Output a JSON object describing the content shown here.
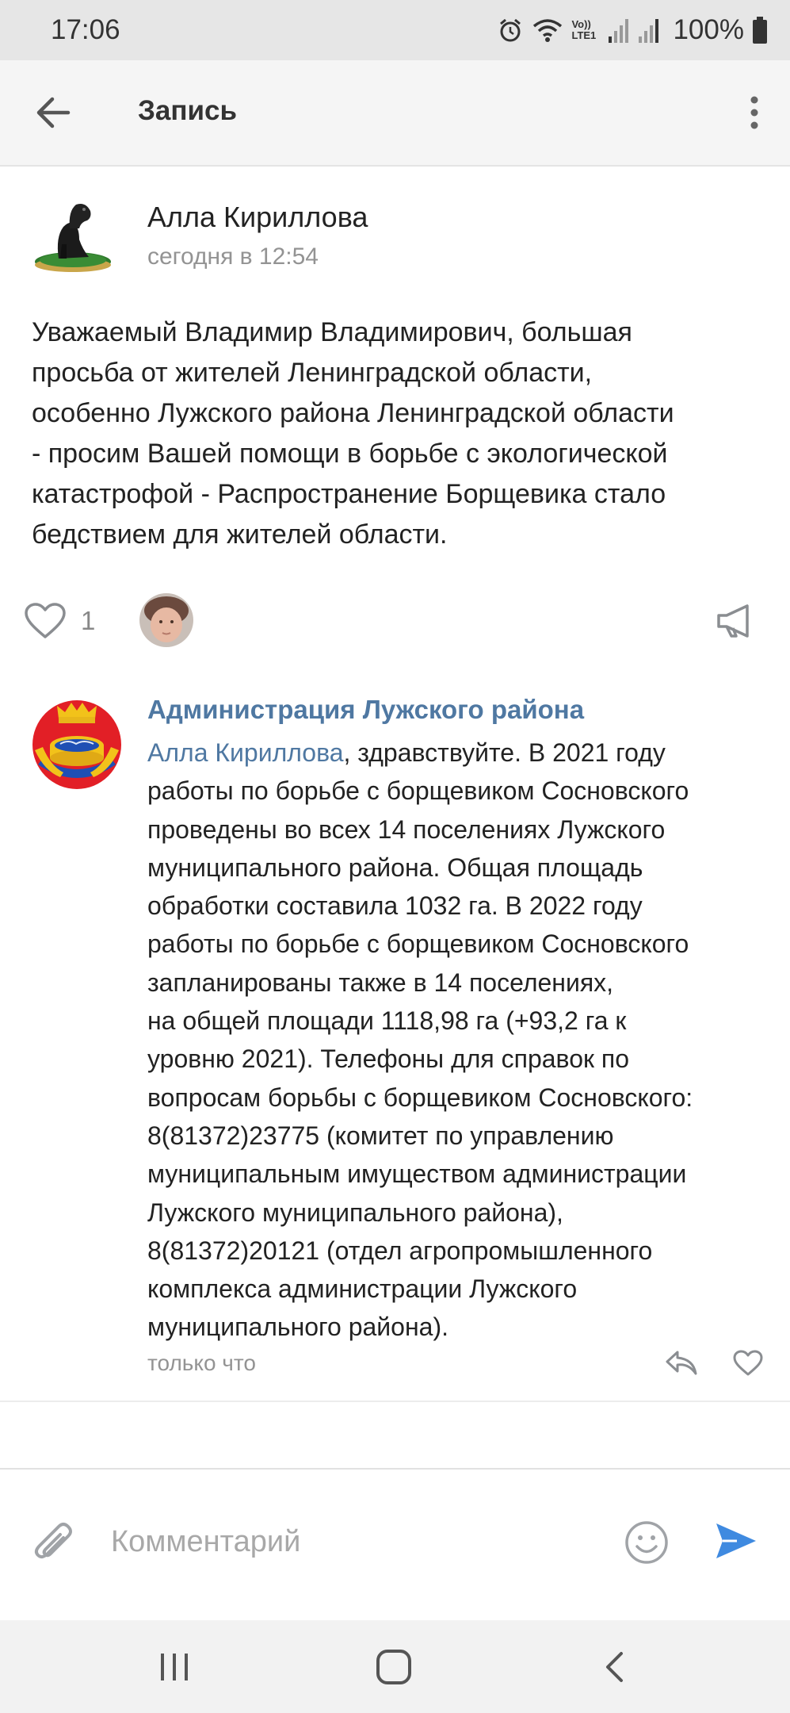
{
  "status_bar": {
    "time": "17:06",
    "network_label": "Vo)) LTE1",
    "battery": "100%"
  },
  "header": {
    "title": "Запись",
    "back_icon": "arrow-left-icon",
    "menu_icon": "more-vertical-icon"
  },
  "post": {
    "author": "Алла Кириллова",
    "time": "сегодня в 12:54",
    "text": "Уважаемый Владимир Владимирович, большая\nпросьба от жителей Ленинградской области,\nособенно Лужского района Ленинградской области\n- просим Вашей помощи в борьбе с экологической\nкатастрофой  - Распространение Борщевика стало\nбедствием для жителей области.",
    "likes": "1"
  },
  "comment": {
    "author": "Администрация Лужского района",
    "mention": "Алла Кириллова",
    "text_first": ", здравствуйте. В 2021 году\n",
    "text_rest": "работы по борьбе с борщевиком Сосновского\nпроведены во всех 14 поселениях Лужского\nмуниципального района. Общая площадь\nобработки составила 1032 га. В 2022 году\nработы по борьбе с борщевиком Сосновского\nзапланированы также в 14 поселениях,\nна общей площади 1118,98 га (+93,2 га к\nуровню 2021). Телефоны для справок по\nвопросам борьбы с борщевиком Сосновского:\n8(81372)23775 (комитет по управлению\nмуниципальным имуществом администрации\nЛужского муниципального района),\n8(81372)20121 (отдел агропромышленного\nкомплекса администрации Лужского\nмуниципального района).",
    "time": "только что"
  },
  "composer": {
    "placeholder": "Комментарий",
    "value": ""
  },
  "colors": {
    "accent": "#4f78a2",
    "send": "#3f8ae0",
    "muted": "#939393"
  }
}
